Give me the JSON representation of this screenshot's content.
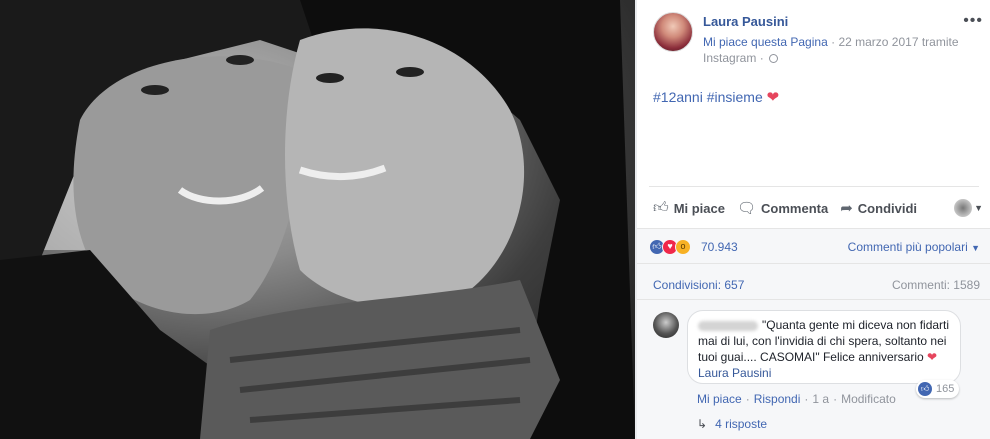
{
  "page": {
    "name": "Laura Pausini",
    "like_page": "Mi piace questa Pagina",
    "date": "22 marzo 2017",
    "via": "tramite",
    "source": "Instagram"
  },
  "post": {
    "hashtag1": "#12anni",
    "hashtag2": "#insieme"
  },
  "actions": {
    "like": "Mi piace",
    "comment": "Commenta",
    "share": "Condividi"
  },
  "stats": {
    "reactions": "70.943",
    "sort_label": "Commenti più popolari",
    "shares": "Condivisioni: 657",
    "comments": "Commenti: 1589"
  },
  "comment": {
    "text": "\"Quanta gente mi diceva non fidarti mai di lui, con l'invidia di chi spera, soltanto nei tuoi guai.... CASOMAI\" Felice anniversario",
    "mention": "Laura Pausini",
    "likes": "165",
    "like_action": "Mi piace",
    "reply_action": "Rispondi",
    "time": "1 a",
    "edited": "Modificato",
    "replies": "4 risposte"
  },
  "colors": {
    "link": "#4267b2",
    "heart": "#e6455d",
    "muted": "#90949c"
  },
  "icons": [
    "more-icon",
    "globe-icon",
    "heart-icon",
    "thumbs-up-icon",
    "comment-icon",
    "share-icon",
    "chevron-down-icon",
    "reply-arrow-icon"
  ]
}
